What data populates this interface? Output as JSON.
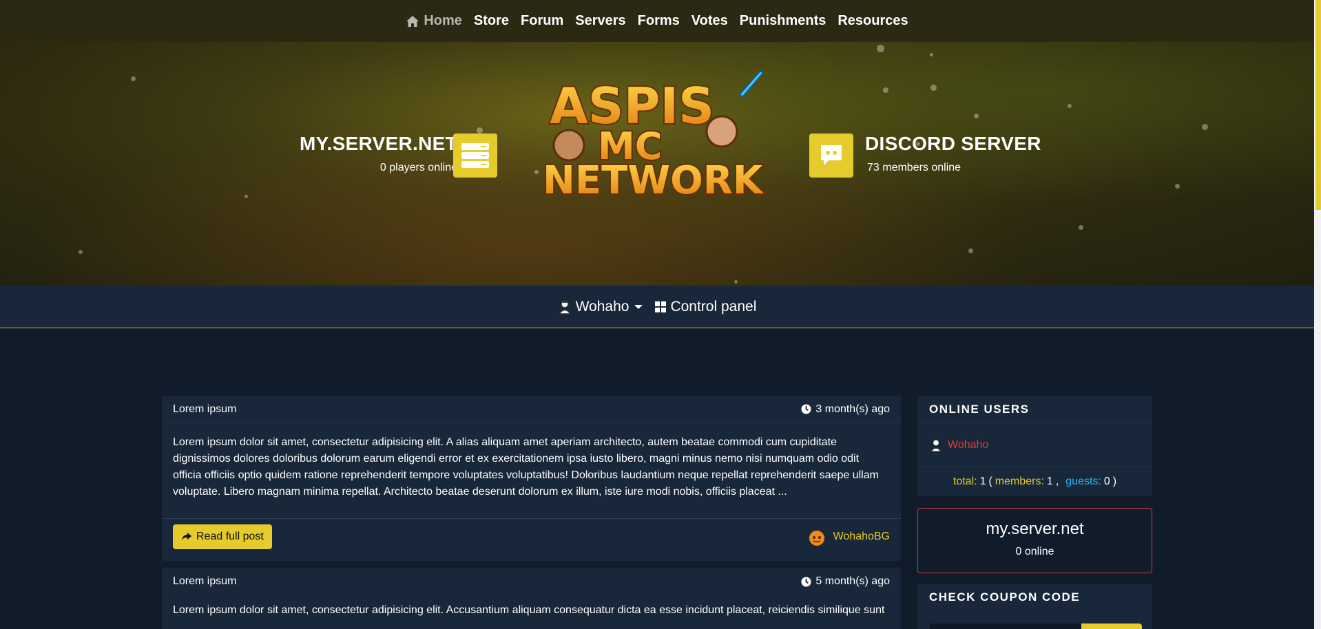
{
  "nav": {
    "items": [
      {
        "label": "Home",
        "active": true
      },
      {
        "label": "Store"
      },
      {
        "label": "Forum"
      },
      {
        "label": "Servers"
      },
      {
        "label": "Forms"
      },
      {
        "label": "Votes"
      },
      {
        "label": "Punishments"
      },
      {
        "label": "Resources"
      }
    ]
  },
  "hero": {
    "server": {
      "title": "MY.SERVER.NET",
      "subtitle": "0 players online"
    },
    "discord": {
      "title": "DISCORD SERVER",
      "subtitle": "73 members online"
    }
  },
  "userbar": {
    "username": "Wohaho",
    "control_panel": "Control panel"
  },
  "posts": [
    {
      "title": "Lorem ipsum",
      "date": "3 month(s) ago",
      "body": "Lorem ipsum dolor sit amet, consectetur adipisicing elit. A alias aliquam amet aperiam architecto, autem beatae commodi cum cupiditate dignissimos dolores doloribus dolorum earum eligendi error et ex exercitationem ipsa iusto libero, magni minus nemo nisi numquam odio odit officia officiis optio quidem ratione reprehenderit tempore voluptates voluptatibus! Doloribus laudantium neque repellat reprehenderit saepe ullam voluptate. Libero magnam minima repellat. Architecto beatae deserunt dolorum ex illum, iste iure modi nobis, officiis placeat ...",
      "read_label": "Read full post",
      "author": "WohahoBG"
    },
    {
      "title": "Lorem ipsum",
      "date": "5 month(s) ago",
      "body": "Lorem ipsum dolor sit amet, consectetur adipisicing elit. Accusantium aliquam consequatur dicta ea esse incidunt placeat, reiciendis similique sunt"
    }
  ],
  "sidebar": {
    "online_users": {
      "title": "ONLINE USERS",
      "user": "Wohaho",
      "total_label": "total:",
      "total": "1",
      "members_label": "members:",
      "members": "1",
      "guests_label": "guests:",
      "guests": "0"
    },
    "server_status": {
      "name": "my.server.net",
      "online": "0 online"
    },
    "coupon": {
      "title": "CHECK COUPON CODE"
    }
  },
  "colors": {
    "accent": "#e6cb2c",
    "page_bg": "#111c2b",
    "card_bg": "#182739",
    "topnav_bg": "#2b2914",
    "user_red": "#e53935",
    "guest_blue": "#29b6f6"
  }
}
